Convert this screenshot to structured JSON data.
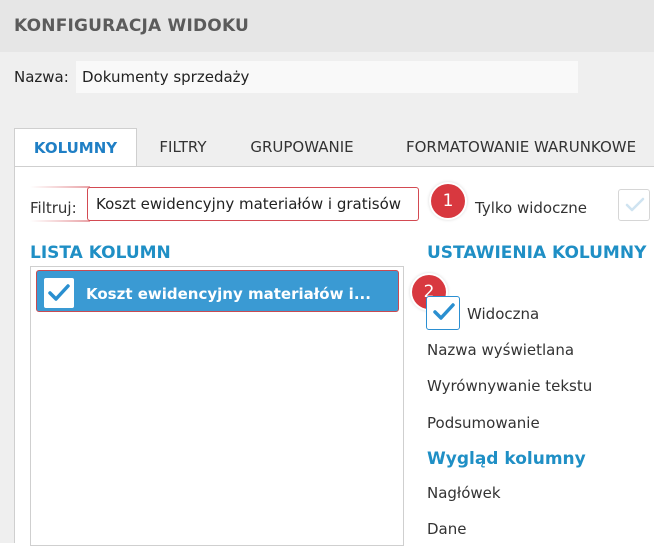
{
  "header": {
    "title": "KONFIGURACJA WIDOKU"
  },
  "name": {
    "label": "Nazwa:",
    "value": "Dokumenty sprzedaży"
  },
  "tabs": [
    {
      "label": "KOLUMNY",
      "active": true
    },
    {
      "label": "FILTRY",
      "active": false
    },
    {
      "label": "GRUPOWANIE",
      "active": false
    },
    {
      "label": "FORMATOWANIE WARUNKOWE",
      "active": false
    }
  ],
  "filter": {
    "label": "Filtruj:",
    "value": "Koszt ewidencyjny materiałów i gratisów",
    "only_visible_label": "Tylko widoczne",
    "only_visible_checked": true
  },
  "badges": {
    "first": "1",
    "second": "2"
  },
  "column_list": {
    "heading": "LISTA KOLUMN",
    "items": [
      {
        "label": "Koszt ewidencyjny materiałów i...",
        "checked": true,
        "selected": true
      }
    ]
  },
  "column_settings": {
    "heading": "USTAWIENIA KOLUMNY",
    "visible_label": "Widoczna",
    "visible_checked": true,
    "display_name_label": "Nazwa wyświetlana",
    "alignment_label": "Wyrównywanie tekstu",
    "summary_label": "Podsumowanie",
    "appearance_heading": "Wygląd kolumny",
    "header_label": "Nagłówek",
    "data_label": "Dane"
  },
  "colors": {
    "accent": "#1f8fc5",
    "selected_row": "#3a9ad3",
    "badge": "#d8383f",
    "header_bg": "#e6e6e6"
  },
  "icons": [
    "check-icon"
  ]
}
